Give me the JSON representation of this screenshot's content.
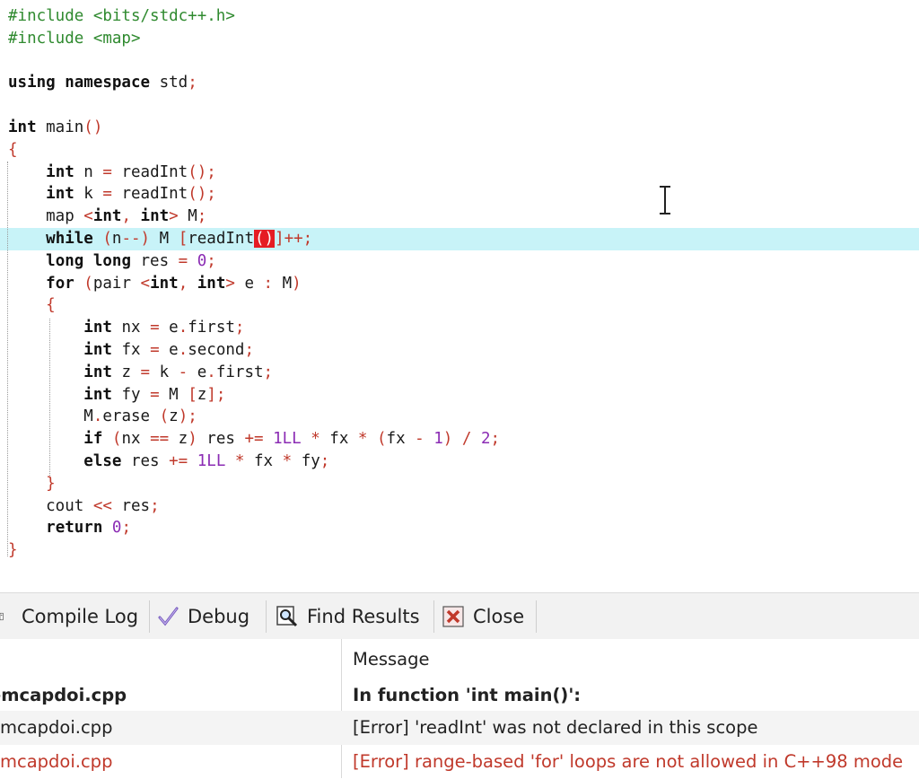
{
  "editor": {
    "lines": [
      [
        {
          "t": "#include <bits/stdc++.h>",
          "c": "pp"
        }
      ],
      [
        {
          "t": "#include <map>",
          "c": "pp"
        }
      ],
      [],
      [
        {
          "t": "using namespace",
          "c": "kw"
        },
        {
          "t": " std",
          "c": "id"
        },
        {
          "t": ";",
          "c": "sym"
        }
      ],
      [],
      [
        {
          "t": "int",
          "c": "kw"
        },
        {
          "t": " main",
          "c": "id"
        },
        {
          "t": "()",
          "c": "sym"
        }
      ],
      [
        {
          "t": "{",
          "c": "sym"
        }
      ],
      [
        {
          "t": "    "
        },
        {
          "t": "int",
          "c": "kw"
        },
        {
          "t": " n ",
          "c": "id"
        },
        {
          "t": "=",
          "c": "sym"
        },
        {
          "t": " readInt",
          "c": "id"
        },
        {
          "t": "();",
          "c": "sym"
        }
      ],
      [
        {
          "t": "    "
        },
        {
          "t": "int",
          "c": "kw"
        },
        {
          "t": " k ",
          "c": "id"
        },
        {
          "t": "=",
          "c": "sym"
        },
        {
          "t": " readInt",
          "c": "id"
        },
        {
          "t": "();",
          "c": "sym"
        }
      ],
      [
        {
          "t": "    map ",
          "c": "id"
        },
        {
          "t": "<",
          "c": "sym"
        },
        {
          "t": "int",
          "c": "kw"
        },
        {
          "t": ", ",
          "c": "sym"
        },
        {
          "t": "int",
          "c": "kw"
        },
        {
          "t": ">",
          "c": "sym"
        },
        {
          "t": " M",
          "c": "id"
        },
        {
          "t": ";",
          "c": "sym"
        }
      ],
      [
        {
          "t": "    "
        },
        {
          "t": "while",
          "c": "kw"
        },
        {
          "t": " (",
          "c": "sym"
        },
        {
          "t": "n",
          "c": "id"
        },
        {
          "t": "--)",
          "c": "sym"
        },
        {
          "t": " M ",
          "c": "id"
        },
        {
          "t": "[",
          "c": "sym"
        },
        {
          "t": "readInt",
          "c": "id"
        },
        {
          "t": "()",
          "c": "err"
        },
        {
          "t": "]++;",
          "c": "sym"
        }
      ],
      [
        {
          "t": "    "
        },
        {
          "t": "long long",
          "c": "kw"
        },
        {
          "t": " res ",
          "c": "id"
        },
        {
          "t": "=",
          "c": "sym"
        },
        {
          "t": " 0",
          "c": "num"
        },
        {
          "t": ";",
          "c": "sym"
        }
      ],
      [
        {
          "t": "    "
        },
        {
          "t": "for",
          "c": "kw"
        },
        {
          "t": " (",
          "c": "sym"
        },
        {
          "t": "pair ",
          "c": "id"
        },
        {
          "t": "<",
          "c": "sym"
        },
        {
          "t": "int",
          "c": "kw"
        },
        {
          "t": ", ",
          "c": "sym"
        },
        {
          "t": "int",
          "c": "kw"
        },
        {
          "t": ">",
          "c": "sym"
        },
        {
          "t": " e ",
          "c": "id"
        },
        {
          "t": ":",
          "c": "sym"
        },
        {
          "t": " M",
          "c": "id"
        },
        {
          "t": ")",
          "c": "sym"
        }
      ],
      [
        {
          "t": "    "
        },
        {
          "t": "{",
          "c": "sym"
        }
      ],
      [
        {
          "t": "        "
        },
        {
          "t": "int",
          "c": "kw"
        },
        {
          "t": " nx ",
          "c": "id"
        },
        {
          "t": "=",
          "c": "sym"
        },
        {
          "t": " e",
          "c": "id"
        },
        {
          "t": ".",
          "c": "sym"
        },
        {
          "t": "first",
          "c": "id"
        },
        {
          "t": ";",
          "c": "sym"
        }
      ],
      [
        {
          "t": "        "
        },
        {
          "t": "int",
          "c": "kw"
        },
        {
          "t": " fx ",
          "c": "id"
        },
        {
          "t": "=",
          "c": "sym"
        },
        {
          "t": " e",
          "c": "id"
        },
        {
          "t": ".",
          "c": "sym"
        },
        {
          "t": "second",
          "c": "id"
        },
        {
          "t": ";",
          "c": "sym"
        }
      ],
      [
        {
          "t": "        "
        },
        {
          "t": "int",
          "c": "kw"
        },
        {
          "t": " z ",
          "c": "id"
        },
        {
          "t": "=",
          "c": "sym"
        },
        {
          "t": " k ",
          "c": "id"
        },
        {
          "t": "-",
          "c": "sym"
        },
        {
          "t": " e",
          "c": "id"
        },
        {
          "t": ".",
          "c": "sym"
        },
        {
          "t": "first",
          "c": "id"
        },
        {
          "t": ";",
          "c": "sym"
        }
      ],
      [
        {
          "t": "        "
        },
        {
          "t": "int",
          "c": "kw"
        },
        {
          "t": " fy ",
          "c": "id"
        },
        {
          "t": "=",
          "c": "sym"
        },
        {
          "t": " M ",
          "c": "id"
        },
        {
          "t": "[",
          "c": "sym"
        },
        {
          "t": "z",
          "c": "id"
        },
        {
          "t": "];",
          "c": "sym"
        }
      ],
      [
        {
          "t": "        M",
          "c": "id"
        },
        {
          "t": ".",
          "c": "sym"
        },
        {
          "t": "erase ",
          "c": "id"
        },
        {
          "t": "(",
          "c": "sym"
        },
        {
          "t": "z",
          "c": "id"
        },
        {
          "t": ");",
          "c": "sym"
        }
      ],
      [
        {
          "t": "        "
        },
        {
          "t": "if",
          "c": "kw"
        },
        {
          "t": " (",
          "c": "sym"
        },
        {
          "t": "nx ",
          "c": "id"
        },
        {
          "t": "==",
          "c": "sym"
        },
        {
          "t": " z",
          "c": "id"
        },
        {
          "t": ")",
          "c": "sym"
        },
        {
          "t": " res ",
          "c": "id"
        },
        {
          "t": "+=",
          "c": "sym"
        },
        {
          "t": " 1LL ",
          "c": "num"
        },
        {
          "t": "*",
          "c": "sym"
        },
        {
          "t": " fx ",
          "c": "id"
        },
        {
          "t": "*",
          "c": "sym"
        },
        {
          "t": " (",
          "c": "sym"
        },
        {
          "t": "fx ",
          "c": "id"
        },
        {
          "t": "-",
          "c": "sym"
        },
        {
          "t": " 1",
          "c": "num"
        },
        {
          "t": ")",
          "c": "sym"
        },
        {
          "t": " /",
          "c": "sym"
        },
        {
          "t": " 2",
          "c": "num"
        },
        {
          "t": ";",
          "c": "sym"
        }
      ],
      [
        {
          "t": "        "
        },
        {
          "t": "else",
          "c": "kw"
        },
        {
          "t": " res ",
          "c": "id"
        },
        {
          "t": "+=",
          "c": "sym"
        },
        {
          "t": " 1LL ",
          "c": "num"
        },
        {
          "t": "*",
          "c": "sym"
        },
        {
          "t": " fx ",
          "c": "id"
        },
        {
          "t": "*",
          "c": "sym"
        },
        {
          "t": " fy",
          "c": "id"
        },
        {
          "t": ";",
          "c": "sym"
        }
      ],
      [
        {
          "t": "    "
        },
        {
          "t": "}",
          "c": "sym"
        }
      ],
      [
        {
          "t": "    cout ",
          "c": "id"
        },
        {
          "t": "<<",
          "c": "sym"
        },
        {
          "t": " res",
          "c": "id"
        },
        {
          "t": ";",
          "c": "sym"
        }
      ],
      [
        {
          "t": "    "
        },
        {
          "t": "return",
          "c": "kw"
        },
        {
          "t": " 0",
          "c": "num"
        },
        {
          "t": ";",
          "c": "sym"
        }
      ],
      [
        {
          "t": "}",
          "c": "sym"
        }
      ]
    ],
    "highlighted_line": 10
  },
  "tabs": {
    "compile_log": "Compile Log",
    "debug": "Debug",
    "find_results": "Find Results",
    "close": "Close"
  },
  "log": {
    "message_header": "Message",
    "rows": [
      {
        "file": "emcapdoi.cpp",
        "message": "In function 'int main()':"
      },
      {
        "file": "emcapdoi.cpp",
        "message": "[Error] 'readInt' was not declared in this scope"
      },
      {
        "file": "emcapdoi.cpp",
        "message": "[Error] range-based 'for' loops are not allowed in C++98 mode"
      }
    ]
  },
  "colors": {
    "highlight": "#c8f3f8",
    "error_box": "#e51c23",
    "error_text": "#c0392b",
    "preprocessor": "#2f8a2f",
    "number": "#8b2cb4"
  }
}
